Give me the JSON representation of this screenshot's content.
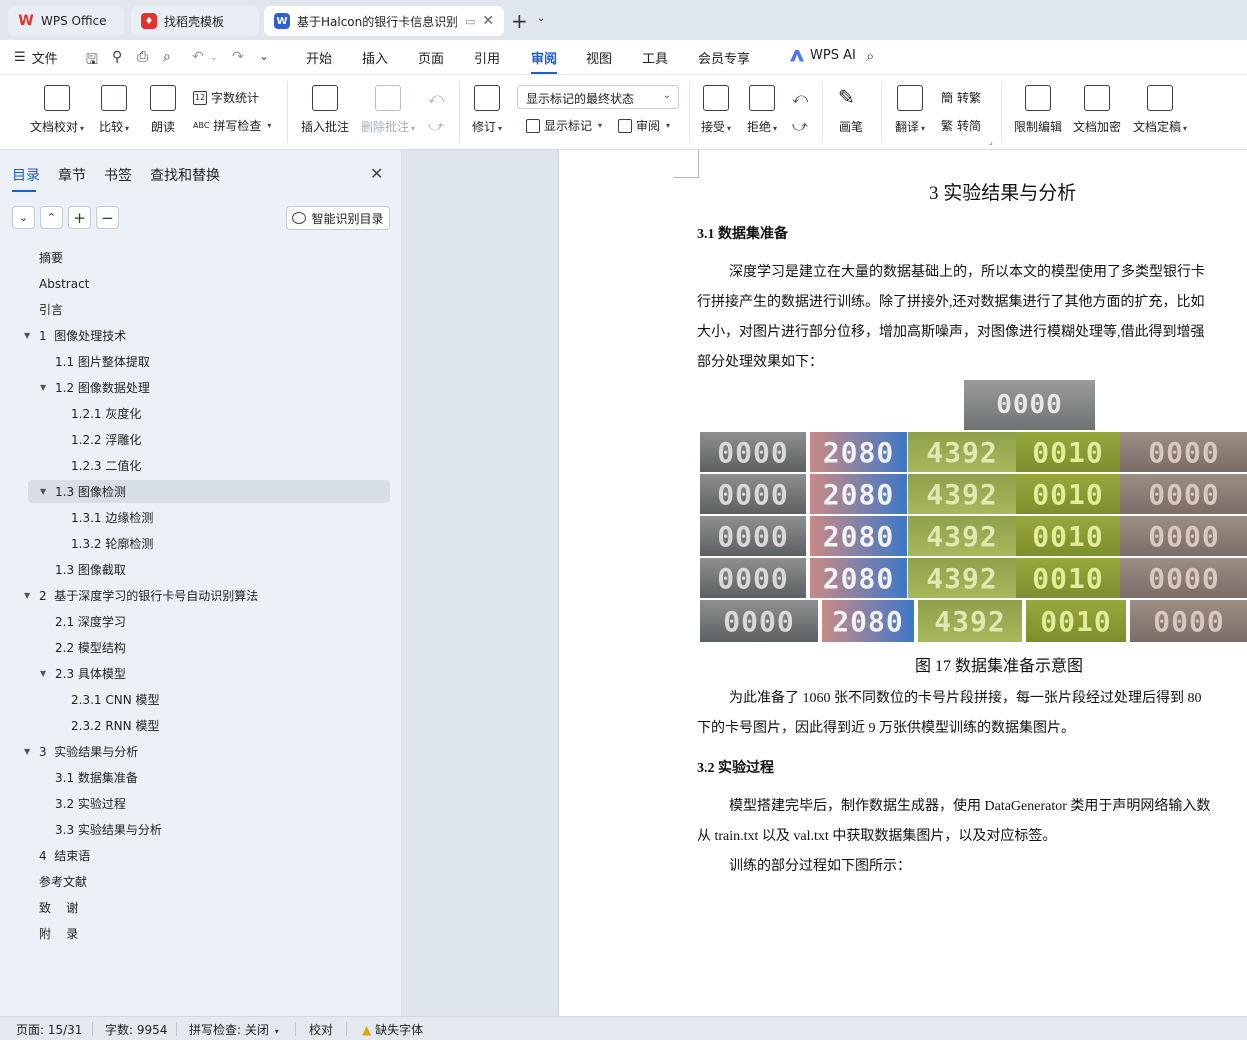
{
  "tabs": [
    {
      "label": "WPS Office"
    },
    {
      "label": "找稻壳模板"
    },
    {
      "label": "基于Halcon的银行卡信息识别"
    }
  ],
  "menu": {
    "file": "文件",
    "items": [
      "开始",
      "插入",
      "页面",
      "引用",
      "审阅",
      "视图",
      "工具",
      "会员专享"
    ],
    "active": "审阅",
    "ai": "WPS AI"
  },
  "ribbon": {
    "proofread": "文档校对",
    "compare": "比较",
    "read_aloud": "朗读",
    "word_count": "字数统计",
    "spell_check": "拼写检查",
    "insert_comment": "插入批注",
    "delete_comment": "删除批注",
    "revise": "修订",
    "markup_dropdown": "显示标记的最终状态",
    "show_markup": "显示标记",
    "review_pane": "审阅",
    "accept": "接受",
    "reject": "拒绝",
    "ink": "画笔",
    "translate": "翻译",
    "to_traditional": "转繁",
    "to_simplified": "转简",
    "restrict_edit": "限制编辑",
    "encrypt": "文档加密",
    "finalize": "文档定稿"
  },
  "nav": {
    "tabs": [
      "目录",
      "章节",
      "书签",
      "查找和替换"
    ],
    "smart_toc": "智能识别目录",
    "toc": [
      {
        "label": "摘要",
        "level": 1
      },
      {
        "label": "Abstract",
        "level": 1
      },
      {
        "label": "引言",
        "level": 1
      },
      {
        "label": "1  图像处理技术",
        "level": 1,
        "expanded": true
      },
      {
        "label": "1.1 图片整体提取",
        "level": 2
      },
      {
        "label": "1.2 图像数据处理",
        "level": 2,
        "expanded": true
      },
      {
        "label": "1.2.1 灰度化",
        "level": 3
      },
      {
        "label": "1.2.2 浮雕化",
        "level": 3
      },
      {
        "label": "1.2.3 二值化",
        "level": 3
      },
      {
        "label": "1.3 图像检测",
        "level": 2,
        "expanded": true,
        "selected": true
      },
      {
        "label": "1.3.1 边缘检测",
        "level": 3
      },
      {
        "label": "1.3.2 轮廓检测",
        "level": 3
      },
      {
        "label": "1.3 图像截取",
        "level": 2
      },
      {
        "label": "2  基于深度学习的银行卡号自动识别算法",
        "level": 1,
        "expanded": true
      },
      {
        "label": "2.1 深度学习",
        "level": 2
      },
      {
        "label": "2.2 模型结构",
        "level": 2
      },
      {
        "label": "2.3 具体模型",
        "level": 2,
        "expanded": true
      },
      {
        "label": "2.3.1 CNN 模型",
        "level": 3
      },
      {
        "label": "2.3.2 RNN 模型",
        "level": 3
      },
      {
        "label": "3  实验结果与分析",
        "level": 1,
        "expanded": true
      },
      {
        "label": "3.1 数据集准备",
        "level": 2
      },
      {
        "label": "3.2 实验过程",
        "level": 2
      },
      {
        "label": "3.3 实验结果与分析",
        "level": 2
      },
      {
        "label": "4  结束语",
        "level": 1
      },
      {
        "label": "参考文献",
        "level": 1
      },
      {
        "label": "致    谢",
        "level": 1
      },
      {
        "label": "附    录",
        "level": 1
      }
    ]
  },
  "doc": {
    "chapter_title": "3  实验结果与分析",
    "sec1_title": "3.1 数据集准备",
    "para1": [
      "深度学习是建立在大量的数据基础上的，所以本文的模型使用了多类型银行卡",
      "行拼接产生的数据进行训练。除了拼接外,还对数据集进行了其他方面的扩充，比如",
      "大小，对图片进行部分位移，增加高斯噪声，对图像进行模糊处理等,借此得到增强",
      "部分处理效果如下："
    ],
    "figure_rows": [
      [
        "0000",
        "2080",
        "4392",
        "0010",
        "0000"
      ],
      [
        "0000",
        "2080",
        "4392",
        "0010",
        "0000"
      ],
      [
        "0000",
        "2080",
        "4392",
        "0010",
        "0000"
      ],
      [
        "0000",
        "2080",
        "4392",
        "0010",
        "0000"
      ]
    ],
    "figure_top": "0000",
    "figure_bottom": [
      "0000",
      "2080",
      "4392",
      "0010",
      "0000"
    ],
    "figure_caption": "图  17  数据集准备示意图",
    "para2": [
      "为此准备了 1060 张不同数位的卡号片段拼接，每一张片段经过处理后得到 80",
      "下的卡号图片，因此得到近 9 万张供模型训练的数据集图片。"
    ],
    "sec2_title": "3.2 实验过程",
    "para3": [
      "模型搭建完毕后，制作数据生成器，使用 DataGenerator 类用于声明网络输入数",
      "从 train.txt 以及  val.txt 中获取数据集图片，以及对应标签。",
      "训练的部分过程如下图所示："
    ]
  },
  "status": {
    "page": "页面: 15/31",
    "words": "字数: 9954",
    "spell": "拼写检查: 关闭",
    "proof": "校对",
    "missing_font": "缺失字体"
  },
  "colors": {
    "accent": "#1e5bd6",
    "wps_red": "#e0332f",
    "doc_blue": "#2f5fd0"
  }
}
